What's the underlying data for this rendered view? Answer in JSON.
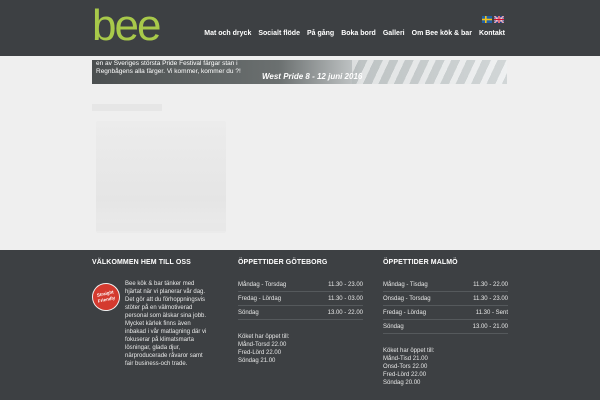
{
  "header": {
    "logo_text": "bee",
    "nav": [
      {
        "label": "Mat och dryck"
      },
      {
        "label": "Socialt flöde"
      },
      {
        "label": "På gång"
      },
      {
        "label": "Boka bord"
      },
      {
        "label": "Galleri"
      },
      {
        "label": "Om Bee kök & bar"
      },
      {
        "label": "Kontakt"
      }
    ],
    "flags": [
      "swedish-flag-icon",
      "english-flag-icon"
    ]
  },
  "banner": {
    "text": "en av Sveriges största Pride Festival färgar stan i Regnbågens alla färger. Vi kommer, kommer du ?!",
    "date_text": "West Pride 8 - 12 juni 2016"
  },
  "footer": {
    "welcome": {
      "title": "VÄLKOMMEN HEM TILL OSS",
      "badge": "Straight Friendly",
      "text": "Bee kök & bar tänker med hjärtat när vi planerar vår dag. Det gör att du förhoppningsvis stöter på en välmotiverad personal som älskar sina jobb. Mycket kärlek finns även inbakad i vår matlagning där vi fokuserar på klimatsmarta lösningar, glada djur, närproducerade råvaror samt fair business-och trade."
    },
    "goteborg": {
      "title": "ÖPPETTIDER GÖTEBORG",
      "rows": [
        {
          "day": "Måndag - Torsdag",
          "time": "11.30 - 23.00"
        },
        {
          "day": "Fredag - Lördag",
          "time": "11.30 - 03.00"
        },
        {
          "day": "Söndag",
          "time": "13.00 - 22.00"
        }
      ],
      "kitchen": [
        "Köket har öppet till:",
        "Månd-Torsd 22.00",
        "Fred-Lörd 22.00",
        "Söndag 21.00"
      ]
    },
    "malmo": {
      "title": "ÖPPETTIDER MALMÖ",
      "rows": [
        {
          "day": "Måndag - Tisdag",
          "time": "11.30 - 22.00"
        },
        {
          "day": "Onsdag - Torsdag",
          "time": "11.30 - 23.00"
        },
        {
          "day": "Fredag - Lördag",
          "time": "11.30 - Sent"
        },
        {
          "day": "Söndag",
          "time": "13.00 - 21.00"
        }
      ],
      "kitchen": [
        "Köket har öppet till:",
        "Månd-Tisd 21.00",
        "Onsd-Tors 22.00",
        "Fred-Lörd 22.00",
        "Söndag 20.00"
      ]
    }
  },
  "colors": {
    "header_bg": "#3d4043",
    "logo_green": "#a8c94a",
    "page_bg": "#efefef"
  }
}
